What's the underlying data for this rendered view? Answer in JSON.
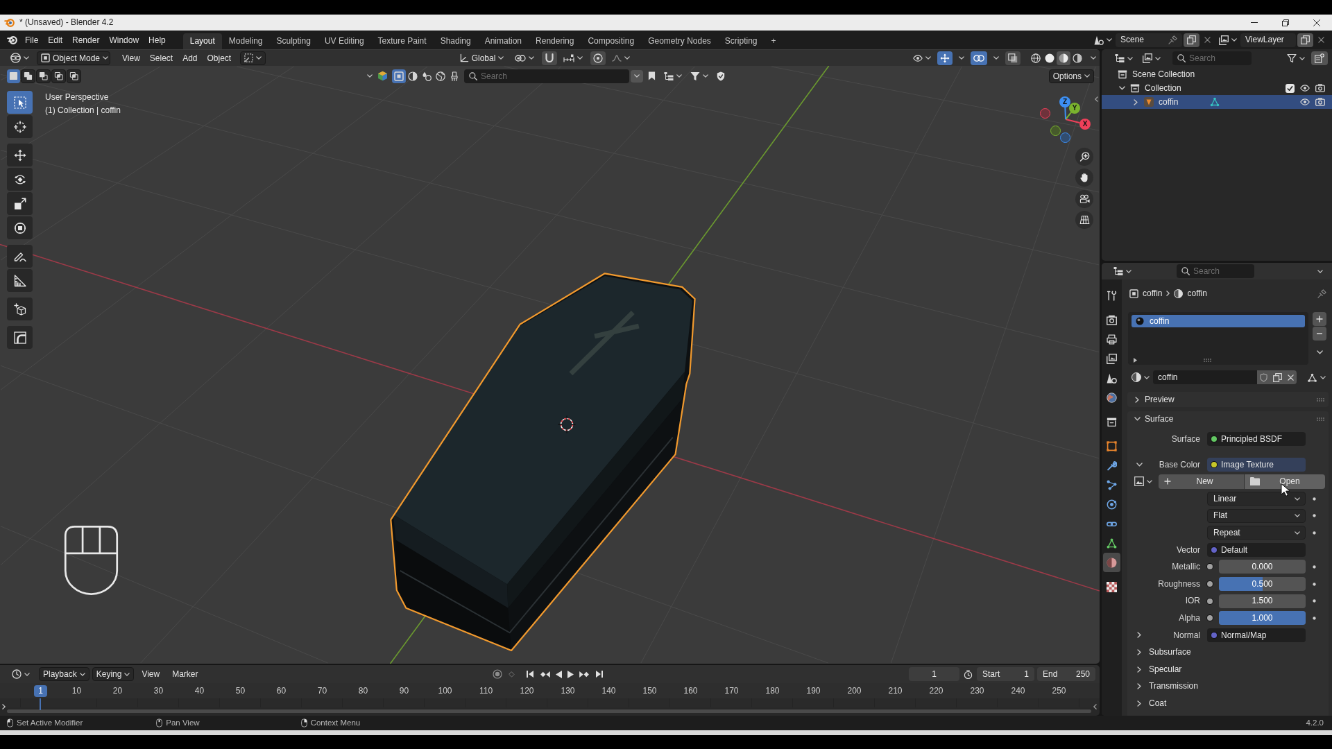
{
  "window": {
    "title": "* (Unsaved) - Blender 4.2"
  },
  "top_bar": {
    "menus": [
      "File",
      "Edit",
      "Render",
      "Window",
      "Help"
    ],
    "workspaces": [
      {
        "label": "Layout",
        "selected": true
      },
      {
        "label": "Modeling",
        "selected": false
      },
      {
        "label": "Sculpting",
        "selected": false
      },
      {
        "label": "UV Editing",
        "selected": false
      },
      {
        "label": "Texture Paint",
        "selected": false
      },
      {
        "label": "Shading",
        "selected": false
      },
      {
        "label": "Animation",
        "selected": false
      },
      {
        "label": "Rendering",
        "selected": false
      },
      {
        "label": "Compositing",
        "selected": false
      },
      {
        "label": "Geometry Nodes",
        "selected": false
      },
      {
        "label": "Scripting",
        "selected": false
      }
    ],
    "add_workspace": "+",
    "scene": "Scene",
    "view_layer": "ViewLayer"
  },
  "viewport": {
    "mode": "Object Mode",
    "menus": [
      "View",
      "Select",
      "Add",
      "Object"
    ],
    "orientation": "Global",
    "toggles": [
      {
        "on": false
      },
      {
        "on": false
      },
      {
        "on": true
      },
      {
        "on": true
      },
      {
        "on": false
      }
    ],
    "shading_modes": [
      {
        "selected": false
      },
      {
        "selected": false
      },
      {
        "selected": true
      },
      {
        "selected": false
      }
    ],
    "select_modes": [
      {
        "selected": true
      },
      {
        "selected": false
      },
      {
        "selected": false
      },
      {
        "selected": false
      },
      {
        "selected": false
      }
    ],
    "object_filters": [
      {
        "selected": true
      },
      {
        "selected": false
      },
      {
        "selected": false
      },
      {
        "selected": false
      },
      {
        "selected": false
      }
    ],
    "search": {
      "placeholder": "Search"
    },
    "options": "Options",
    "info": [
      "User Perspective",
      "(1) Collection | coffin"
    ],
    "tools": [
      {
        "selected": true
      },
      {
        "selected": false
      },
      {
        "selected": false
      },
      {
        "selected": false
      },
      {
        "selected": false
      },
      {
        "selected": false
      },
      {
        "selected": false
      },
      {
        "selected": false
      },
      {
        "selected": false
      },
      {
        "selected": false
      }
    ],
    "gizmo_axes": [
      {
        "label": "X",
        "color": "#f0405a"
      },
      {
        "label": "Y",
        "color": "#7ab32e"
      },
      {
        "label": "Z",
        "color": "#3d8ff2"
      }
    ]
  },
  "outliner": {
    "search": {
      "placeholder": "Search"
    },
    "tree": [
      {
        "kind": "scene_collection",
        "label": "Scene Collection",
        "children": [
          {
            "kind": "collection",
            "label": "Collection",
            "expanded": true,
            "selected": false,
            "checked": true,
            "children": [
              {
                "kind": "object",
                "label": "coffin",
                "expanded": false,
                "selected": true
              }
            ]
          }
        ]
      }
    ]
  },
  "properties": {
    "search": {
      "placeholder": "Search"
    },
    "tabs": [
      {
        "selected": false
      },
      {
        "selected": false
      },
      {
        "selected": false
      },
      {
        "selected": false
      },
      {
        "selected": false
      },
      {
        "selected": false
      },
      {
        "selected": false
      },
      {
        "selected": false
      },
      {
        "selected": false
      },
      {
        "selected": false
      },
      {
        "selected": false
      },
      {
        "selected": false
      },
      {
        "selected": false
      },
      {
        "selected": true
      },
      {
        "selected": false
      }
    ],
    "breadcrumb": [
      "coffin",
      "coffin"
    ],
    "material_slots": [
      {
        "name": "coffin",
        "selected": true
      }
    ],
    "material_name": "coffin",
    "panels": [
      {
        "label": "Preview",
        "expanded": false
      },
      {
        "label": "Surface",
        "expanded": true
      }
    ],
    "surface_rows": [
      {
        "kind": "socket",
        "label": "Surface",
        "value": "Principled BSDF",
        "color": "#63c763"
      },
      {
        "kind": "socket_group",
        "label": "Base Color",
        "value": "Image Texture",
        "color": "#c7c729",
        "expanded": true
      },
      {
        "kind": "image_buttons",
        "buttons": [
          "New",
          "Open"
        ]
      },
      {
        "kind": "dropdown",
        "value": "Linear"
      },
      {
        "kind": "dropdown",
        "value": "Flat"
      },
      {
        "kind": "dropdown",
        "value": "Repeat"
      },
      {
        "kind": "socket",
        "label": "Vector",
        "value": "Default",
        "color": "#6363c7"
      },
      {
        "kind": "slider",
        "label": "Metallic",
        "value": "0.000",
        "level": 0,
        "color": "#a1a1a1"
      },
      {
        "kind": "slider",
        "label": "Roughness",
        "value": "0.500",
        "level": 0.5,
        "color": "#a1a1a1"
      },
      {
        "kind": "number",
        "label": "IOR",
        "value": "1.500",
        "color": "#a1a1a1"
      },
      {
        "kind": "slider",
        "label": "Alpha",
        "value": "1.000",
        "level": 1,
        "color": "#a1a1a1"
      },
      {
        "kind": "socket_group",
        "label": "Normal",
        "value": "Normal/Map",
        "color": "#6363c7",
        "expanded": false
      },
      {
        "kind": "subpanel",
        "label": "Subsurface",
        "expanded": false
      },
      {
        "kind": "subpanel",
        "label": "Specular",
        "expanded": false
      },
      {
        "kind": "subpanel",
        "label": "Transmission",
        "expanded": false
      },
      {
        "kind": "subpanel",
        "label": "Coat",
        "expanded": false
      }
    ]
  },
  "timeline": {
    "menus": [
      {
        "label": "Playback",
        "kind": "popover"
      },
      {
        "label": "Keying",
        "kind": "popover"
      },
      {
        "label": "View",
        "kind": "menu"
      },
      {
        "label": "Marker",
        "kind": "menu"
      }
    ],
    "current_frame": "1",
    "start": {
      "label": "Start",
      "value": "1"
    },
    "end": {
      "label": "End",
      "value": "250"
    },
    "playhead": "1",
    "ticks": [
      "10",
      "20",
      "30",
      "40",
      "50",
      "60",
      "70",
      "80",
      "90",
      "100",
      "110",
      "120",
      "130",
      "140",
      "150",
      "160",
      "170",
      "180",
      "190",
      "200",
      "210",
      "220",
      "230",
      "240",
      "250"
    ]
  },
  "status_bar": {
    "hints": [
      "Set Active Modifier",
      "Pan View",
      "Context Menu"
    ],
    "version": "4.2.0"
  }
}
